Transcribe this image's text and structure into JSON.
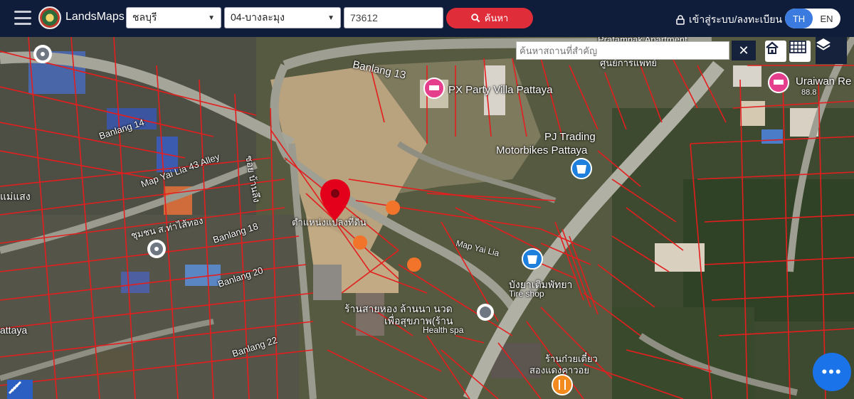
{
  "header": {
    "brand": "LandsMaps",
    "province": "ชลบุรี",
    "district": "04-บางละมุง",
    "parcel_number": "73612",
    "search_label": "ค้นหา",
    "login_label": "เข้าสู่ระบบ/ลงทะเบียน",
    "lang_th": "TH",
    "lang_en": "EN"
  },
  "map": {
    "place_search_placeholder": "ค้นหาสถานที่สำคัญ",
    "labels": {
      "banlang13": "Banlang 13",
      "banlang14": "Banlang 14",
      "banlang18": "Banlang 18",
      "banlang20": "Banlang 20",
      "banlang22": "Banlang 22",
      "alley": "Map Yai Lia 43 Alley",
      "soi": "ซอย บ้านลึง",
      "maeseng": "แม่แสง",
      "chumchon": "ชุมชน ส.ท่าไส้ทอง",
      "pin_label": "ตำแหน่งแปลงที่ดิน",
      "map_yai_lia": "Map Yai Lia",
      "px_party": "PX Party Villa Pattaya",
      "pj_trading_1": "PJ Trading",
      "pj_trading_2": "Motorbikes Pattaya",
      "tire_shop_th": "บังยาเติมพัทยา",
      "tire_shop_en": "Tire shop",
      "health_1": "ร้านสายหอง ล้านนา นวด",
      "health_2": "เพื่อสุขภาพ(ร้าน",
      "health_3": "Health spa",
      "uraiwan_1": "Uraiwan Re",
      "uraiwan_2": "88.8",
      "pattaya": "attaya",
      "rest_1": "ร้านก๋วยเตี๋ยว",
      "rest_2": "สองแดงคาวอย",
      "top_apartment": "Pratamnak Apartment",
      "top_right": "ศูนย์การแพทย์"
    }
  },
  "colors": {
    "topbar": "#101d3a",
    "search_button": "#e02d3a",
    "parcel_lines": "#e41e1e",
    "pin": "#e3001b",
    "marker_orange": "#f2742b",
    "lang_active": "#3b7be0",
    "fab": "#1a73e8"
  },
  "icons": {
    "menu": "hamburger-icon",
    "search": "search-icon",
    "lock": "lock-icon",
    "clear": "close-icon",
    "home": "home-icon",
    "grid": "grid-icon",
    "layers": "layers-icon",
    "chat": "chat-icon",
    "measure": "ruler-icon"
  }
}
